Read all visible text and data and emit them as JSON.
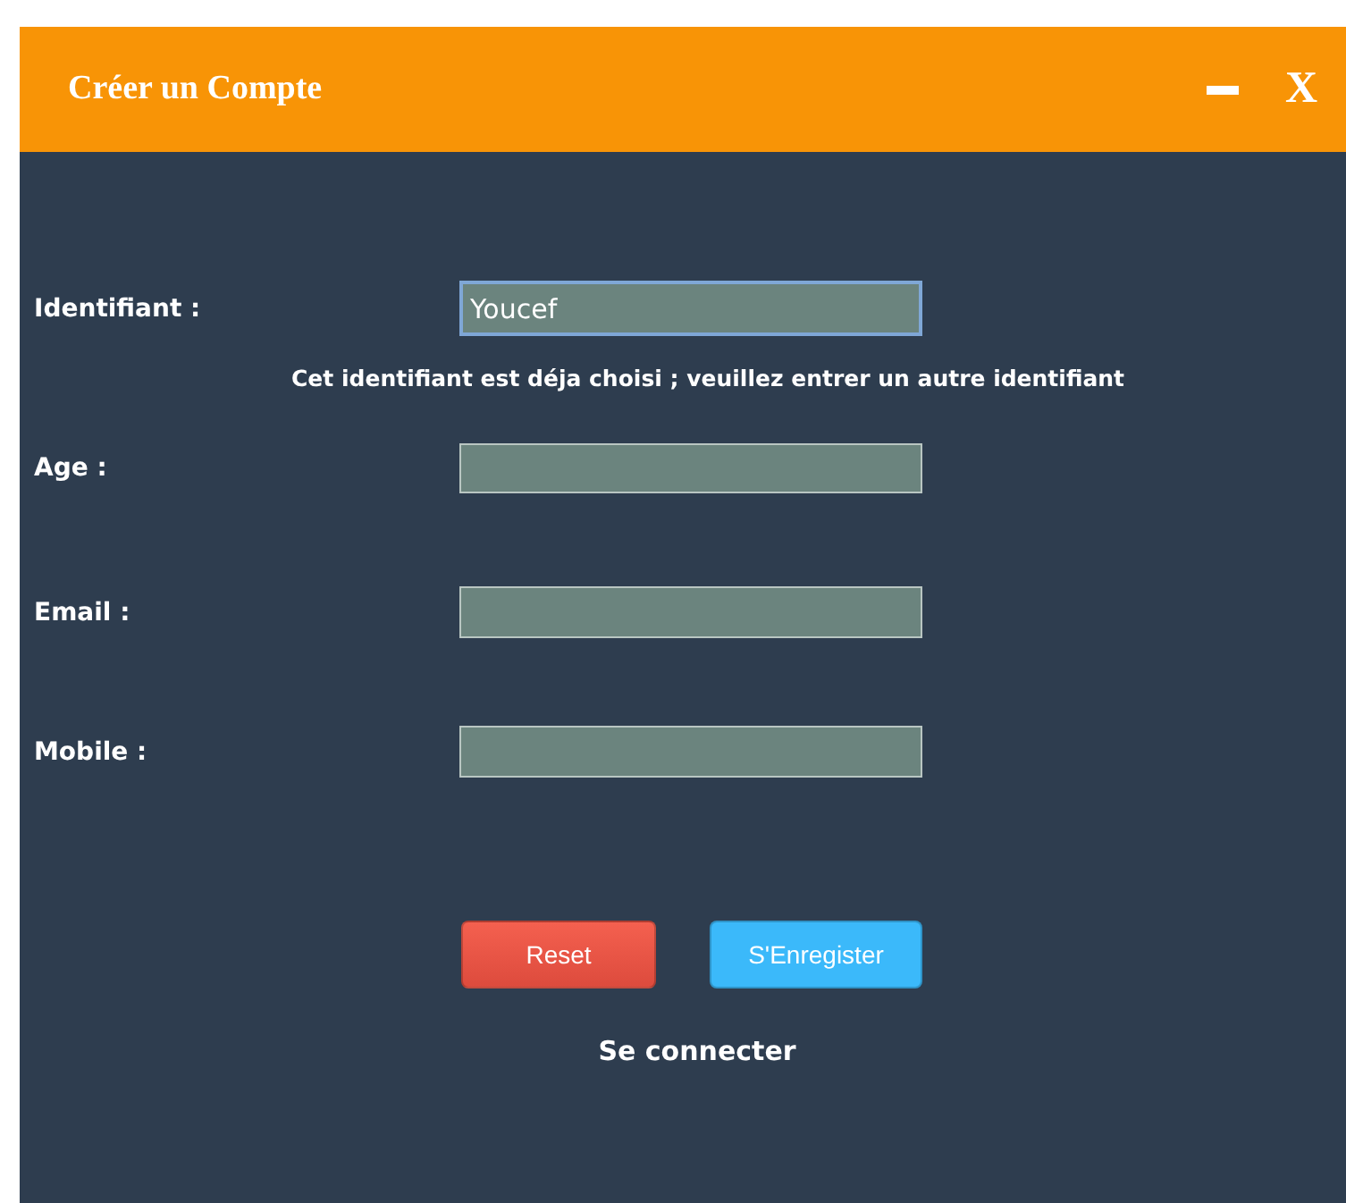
{
  "window": {
    "title": "Créer un Compte",
    "close_label": "X"
  },
  "fields": [
    {
      "label": "Identifiant :",
      "value": "Youcef",
      "focused": true,
      "message": "Cet identifiant est déja choisi ; veuillez entrer un autre identifiant"
    },
    {
      "label": "Age :",
      "focused": false
    },
    {
      "label": "Email :",
      "focused": false
    },
    {
      "label": "Mobile :",
      "focused": false
    }
  ],
  "buttons": [
    {
      "label": "Reset",
      "kind": "reset"
    },
    {
      "label": "S'Enregister",
      "kind": "submit"
    }
  ],
  "link": "Se connecter"
}
